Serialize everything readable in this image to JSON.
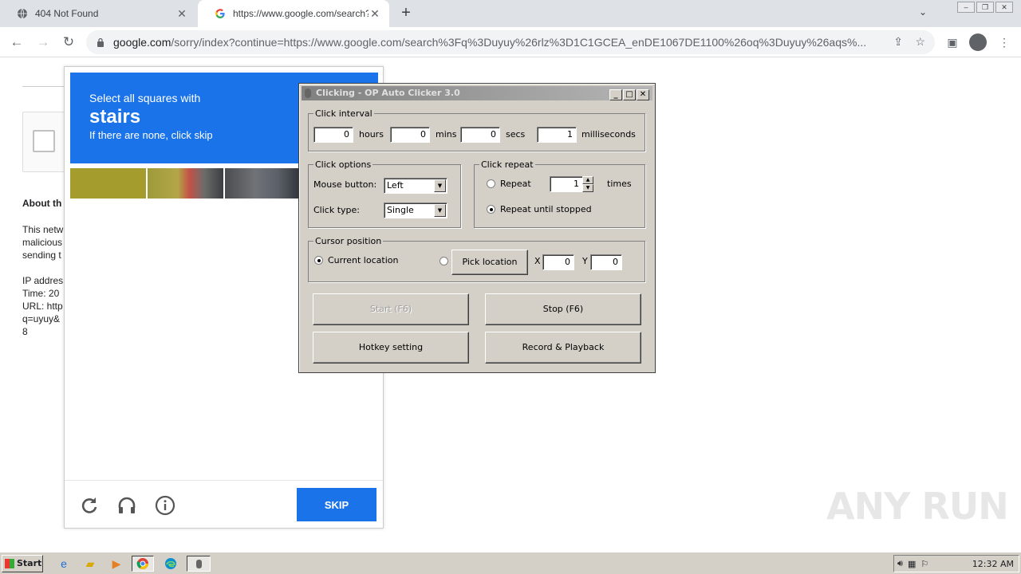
{
  "browser": {
    "tabs": [
      {
        "title": "404 Not Found",
        "icon": "globe-icon"
      },
      {
        "title": "https://www.google.com/search?q=",
        "icon": "google-icon"
      }
    ],
    "address": {
      "host": "google.com",
      "path": "/sorry/index?continue=https://www.google.com/search%3Fq%3Duyuy%26rlz%3D1C1GCEA_enDE1067DE1100%26oq%3Duyuy%26aqs%..."
    }
  },
  "page": {
    "about_heading": "About th",
    "para_lines": [
      "This netw",
      "malicious",
      "sending t",
      "",
      "IP addres",
      "Time: 20",
      "URL: http",
      "q=uyuy&",
      "8"
    ]
  },
  "captcha": {
    "instruction": "Select all squares with",
    "keyword": "stairs",
    "hint": "If there are none, click skip",
    "skip_label": "SKIP"
  },
  "clicker": {
    "title": "Clicking - OP Auto Clicker 3.0",
    "interval": {
      "legend": "Click interval",
      "hours": "0",
      "hours_label": "hours",
      "mins": "0",
      "mins_label": "mins",
      "secs": "0",
      "secs_label": "secs",
      "ms": "1",
      "ms_label": "milliseconds"
    },
    "options": {
      "legend": "Click options",
      "mouse_label": "Mouse button:",
      "mouse_value": "Left",
      "type_label": "Click type:",
      "type_value": "Single"
    },
    "repeat": {
      "legend": "Click repeat",
      "repeat_label": "Repeat",
      "repeat_count": "1",
      "times_label": "times",
      "until_label": "Repeat until stopped"
    },
    "cursor": {
      "legend": "Cursor position",
      "current_label": "Current location",
      "pick_label": "Pick location",
      "x_label": "X",
      "x_value": "0",
      "y_label": "Y",
      "y_value": "0"
    },
    "buttons": {
      "start": "Start (F6)",
      "stop": "Stop (F6)",
      "hotkey": "Hotkey setting",
      "record": "Record & Playback"
    }
  },
  "watermark": "ANY RUN",
  "taskbar": {
    "start_label": "Start",
    "clock": "12:32 AM"
  }
}
